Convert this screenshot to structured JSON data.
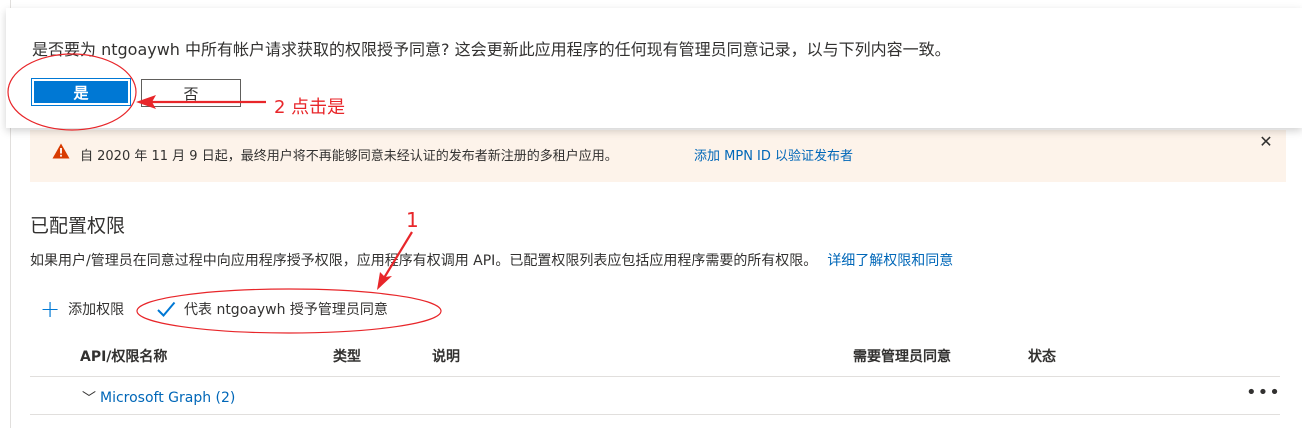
{
  "confirm": {
    "message": "是否要为 ntgoaywh 中所有帐户请求获取的权限授予同意? 这会更新此应用程序的任何现有管理员同意记录，以与下列内容一致。",
    "yes_label": "是",
    "no_label": "否"
  },
  "annotations": {
    "step2": "2 点击是",
    "step1": "1",
    "color": "#e8262a"
  },
  "banner": {
    "text": "自 2020 年 11 月 9 日起，最终用户将不再能够同意未经认证的发布者新注册的多租户应用。",
    "link": "添加 MPN ID 以验证发布者",
    "close_icon": "close-icon",
    "warning_icon": "warning-icon"
  },
  "section": {
    "title": "已配置权限",
    "description": "如果用户/管理员在同意过程中向应用程序授予权限，应用程序有权调用 API。已配置权限列表应包括应用程序需要的所有权限。",
    "learn_more": "详细了解权限和同意"
  },
  "toolbar": {
    "add_label": "添加权限",
    "grant_label": "代表 ntgoaywh 授予管理员同意"
  },
  "table": {
    "headers": [
      "API/权限名称",
      "类型",
      "说明",
      "需要管理员同意",
      "状态"
    ],
    "group_label": "Microsoft Graph (2)"
  },
  "colors": {
    "accent": "#0078d4",
    "link": "#0067b8",
    "warning": "#d83b01",
    "banner_bg": "#fdf3ea"
  }
}
